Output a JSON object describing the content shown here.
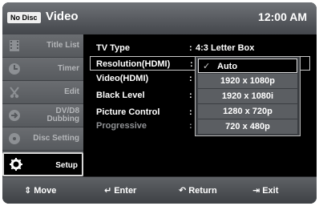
{
  "header": {
    "disc_badge": "No Disc",
    "title": "Video",
    "time": "12:00 AM"
  },
  "sidebar": {
    "items": [
      {
        "label": "Title List",
        "icon": "film-icon"
      },
      {
        "label": "Timer",
        "icon": "timer-icon"
      },
      {
        "label": "Edit",
        "icon": "scissors-icon"
      },
      {
        "label": "DV/D8 Dubbing",
        "icon": "dubbing-icon"
      },
      {
        "label": "Disc Setting",
        "icon": "disc-icon"
      },
      {
        "label": "Setup",
        "icon": "gear-icon",
        "active": true
      }
    ]
  },
  "settings": {
    "rows": [
      {
        "label": "TV Type",
        "value": "4:3 Letter Box"
      },
      {
        "label": "Resolution(HDMI)",
        "value": "",
        "selected": true
      },
      {
        "label": "Video(HDMI)",
        "value": ""
      },
      {
        "label": "Black Level",
        "value": ""
      },
      {
        "label": "Picture Control",
        "value": ""
      },
      {
        "label": "Progressive",
        "value": "",
        "disabled": true
      }
    ]
  },
  "resolution_dropdown": {
    "options": [
      "Auto",
      "1920 x 1080p",
      "1920 x 1080i",
      "1280 x 720p",
      "720 x 480p"
    ],
    "selected": "Auto"
  },
  "footer": {
    "move": "Move",
    "enter": "Enter",
    "return": "Return",
    "exit": "Exit"
  },
  "colors": {
    "background": "#000000",
    "header": "#5a5d61",
    "sidebar": "#55585c",
    "highlight_border": "#d8d8d8"
  }
}
